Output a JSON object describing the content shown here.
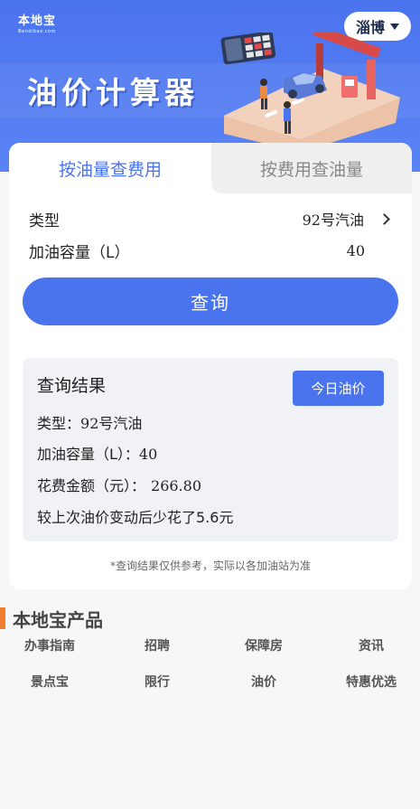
{
  "header": {
    "logo_text": "本地宝",
    "logo_sub": "Bendibao.com",
    "title": "油价计算器",
    "city": "淄博"
  },
  "tabs": [
    {
      "label": "按油量查费用",
      "active": true
    },
    {
      "label": "按费用查油量",
      "active": false
    }
  ],
  "form": {
    "type_label": "类型",
    "type_value": "92号汽油",
    "volume_label": "加油容量（L）",
    "volume_value": "40",
    "query_button": "查询"
  },
  "result": {
    "title": "查询结果",
    "today_price_button": "今日油价",
    "type_prefix": "类型：",
    "type_value": "92号汽油",
    "volume_prefix": "加油容量（L）：",
    "volume_value": "40",
    "cost_prefix": "花费金额（元）：",
    "cost_value": "266.80",
    "change_text": "较上次油价变动后少花了5.6元"
  },
  "disclaimer": "*查询结果仅供参考，实际以各加油站为准",
  "products": {
    "title": "本地宝产品",
    "items": [
      "办事指南",
      "招聘",
      "保障房",
      "资讯",
      "景点宝",
      "限行",
      "油价",
      "特惠优选"
    ]
  },
  "colors": {
    "brand_blue": "#4a73ee",
    "accent_orange": "#ee7d2e"
  }
}
